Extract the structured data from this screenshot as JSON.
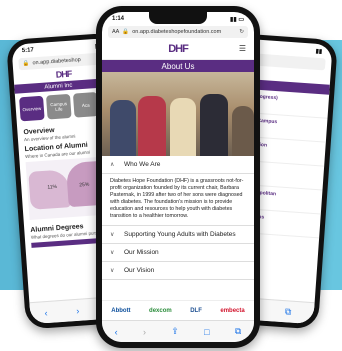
{
  "background": {
    "band_color": "#68c6e0"
  },
  "left_phone": {
    "time": "5:17",
    "url": "on.app.diabeteshop",
    "logo": "DHF",
    "banner": "Alumni Inc",
    "tabs": [
      "Overview",
      "Campus Life",
      "Aca"
    ],
    "section1_title": "Overview",
    "section1_text": "An overview of the alumni",
    "section2_title": "Location of Alumni",
    "section2_text": "Where in Canada are our alumni",
    "section3_title": "Alumni Degrees",
    "section3_text": "What degrees do our alumni pursuing?",
    "map_labels": [
      "11%",
      "25%"
    ]
  },
  "center_phone": {
    "time": "1:14",
    "url": "on.app.diabeteshopefoundation.com",
    "url_prefix": "AA",
    "logo": "DHF",
    "logo_sub": "diabetes hope foundation",
    "banner": "About Us",
    "accordion": [
      {
        "label": "Who We Are",
        "open": true
      },
      {
        "label": "Supporting Young Adults with Diabetes",
        "open": false
      },
      {
        "label": "Our Mission",
        "open": false
      },
      {
        "label": "Our Vision",
        "open": false
      }
    ],
    "who_text": "Diabetes Hope Foundation (DHF) is a grassroots not-for-profit organization founded by its current chair, Barbara Pasternak, in 1999 after two of her sons were diagnosed with diabetes. The foundation's mission is to provide education and resources to help youth with diabetes transition to a healthier tomorrow.",
    "sponsors": [
      "Abbott",
      "dexcom",
      "DLF",
      "embecta"
    ]
  },
  "right_phone": {
    "time": "",
    "url": "",
    "banner": "Results",
    "items": [
      "Toronto (Progress)",
      "— Toronto Campus",
      "h Campus ation",
      "and Design",
      "Toronto Metropolitan",
      "Toronto Campus"
    ]
  },
  "colors": {
    "brand_purple": "#5a2d82",
    "link_blue": "#1a73e8"
  }
}
